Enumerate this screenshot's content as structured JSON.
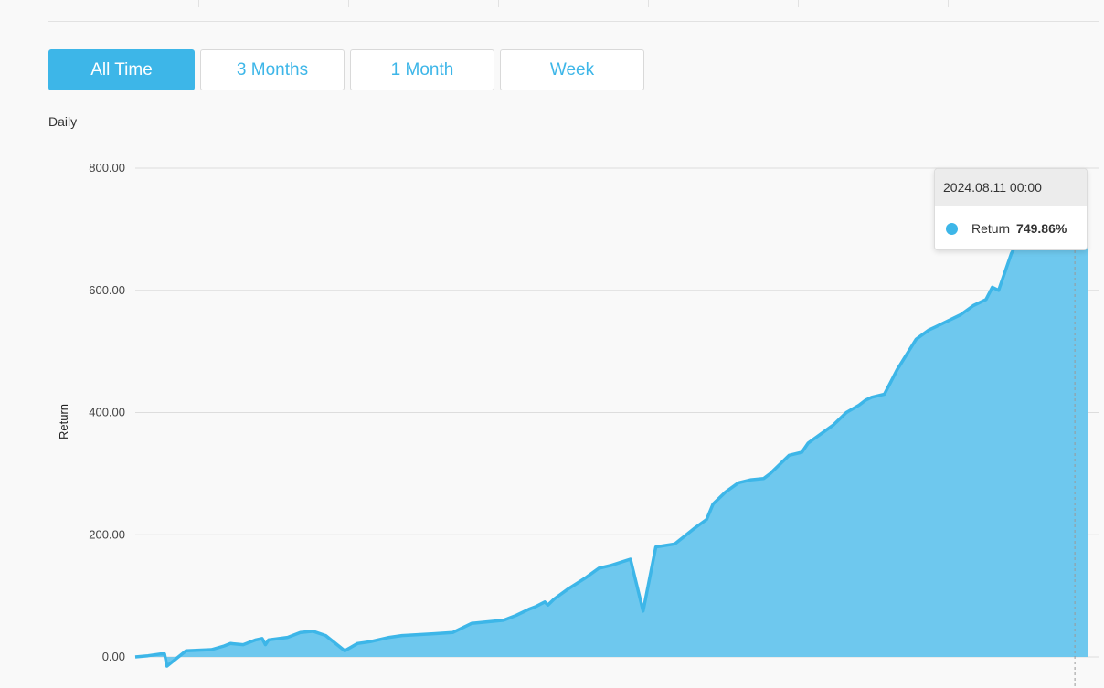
{
  "tabs": [
    {
      "label": "All Time",
      "active": true
    },
    {
      "label": "3 Months",
      "active": false
    },
    {
      "label": "1 Month",
      "active": false
    },
    {
      "label": "Week",
      "active": false
    }
  ],
  "period_label": "Daily",
  "tooltip": {
    "date": "2024.08.11 00:00",
    "series_name": "Return",
    "value": "749.86%"
  },
  "colors": {
    "accent": "#3db6e8",
    "area_fill": "#6ec8ee",
    "line": "#3db6e8",
    "grid": "#dddddd"
  },
  "chart_data": {
    "type": "area",
    "title": "",
    "xlabel": "",
    "ylabel": "Return",
    "ylim": [
      0,
      800
    ],
    "y_ticks": [
      "0.00",
      "200.00",
      "400.00",
      "600.00",
      "800.00"
    ],
    "grid": true,
    "x_tick_labels_visible": false,
    "series": [
      {
        "name": "Return",
        "x": [
          0,
          2,
          4,
          4.6,
          5,
          8,
          12,
          14,
          15,
          17,
          19,
          20,
          20.5,
          21,
          24,
          26,
          28,
          30,
          33,
          35,
          37,
          40,
          42,
          47,
          50,
          53,
          58,
          60,
          62,
          63,
          64.5,
          65,
          66,
          68,
          71,
          73,
          75,
          78,
          80,
          82,
          85,
          88,
          90,
          91,
          93,
          95,
          97,
          99,
          100,
          103,
          105,
          106,
          108,
          110,
          112,
          114,
          115,
          116,
          118,
          119,
          120,
          123,
          125,
          126,
          128,
          130,
          132,
          134,
          135,
          136,
          138,
          140,
          142,
          143,
          145,
          146,
          147,
          148,
          150
        ],
        "y": [
          0,
          2,
          5,
          5,
          -15,
          10,
          12,
          18,
          22,
          20,
          28,
          30,
          20,
          28,
          32,
          40,
          42,
          35,
          10,
          22,
          25,
          32,
          35,
          38,
          40,
          55,
          60,
          68,
          78,
          82,
          90,
          85,
          95,
          110,
          130,
          145,
          150,
          160,
          75,
          180,
          185,
          210,
          225,
          250,
          270,
          285,
          290,
          292,
          300,
          330,
          335,
          350,
          365,
          380,
          400,
          412,
          420,
          425,
          430,
          450,
          470,
          520,
          535,
          540,
          550,
          560,
          575,
          585,
          605,
          600,
          660,
          700,
          715,
          740,
          755,
          765,
          762,
          750,
          765
        ]
      }
    ],
    "hover_point": {
      "x": 148,
      "y": 749.86
    }
  }
}
